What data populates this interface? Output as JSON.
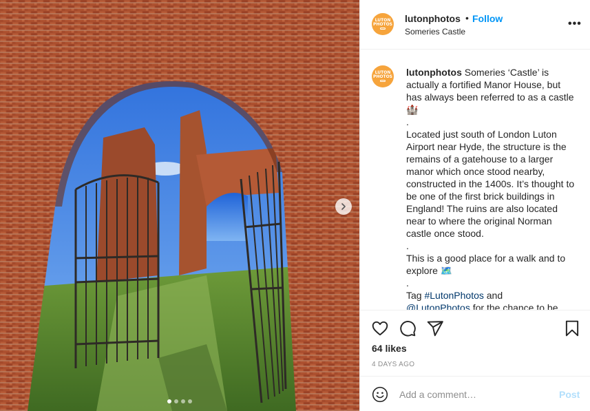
{
  "post": {
    "image_alt": "",
    "carousel": {
      "total": 4,
      "current": 1
    }
  },
  "header": {
    "username": "lutonphotos",
    "separator": "•",
    "follow_label": "Follow",
    "location": "Someries Castle",
    "avatar_text_line1": "LUTON",
    "avatar_text_line2": "PHOTOS",
    "more_label": "•••"
  },
  "caption": {
    "username": "lutonphotos",
    "line1": "Someries ‘Castle’ is actually a fortified Manor House, but has always been referred to as a castle 🏰",
    "dot1": ".",
    "line2": "Located just south of London Luton Airport near Hyde, the structure is the remains of a gatehouse to a larger manor which once stood nearby, constructed in the 1400s. It’s thought to be one of the first brick buildings in England! The ruins are also located near to where the original Norman castle once stood.",
    "dot2": ".",
    "line3": "This is a good place for a walk and to explore 🗺️",
    "dot3": ".",
    "tag_prefix": "Tag ",
    "hashtag": "#LutonPhotos",
    "tag_and": " and",
    "mention": "@LutonPhotos",
    "tag_suffix": " for the chance to be"
  },
  "actions": {
    "likes": "64 likes",
    "posted": "4 DAYS AGO"
  },
  "comment": {
    "placeholder": "Add a comment…",
    "post_label": "Post"
  },
  "colors": {
    "accent": "#0095f6",
    "avatar": "#f6a43c",
    "post_disabled": "#b2dffc"
  }
}
